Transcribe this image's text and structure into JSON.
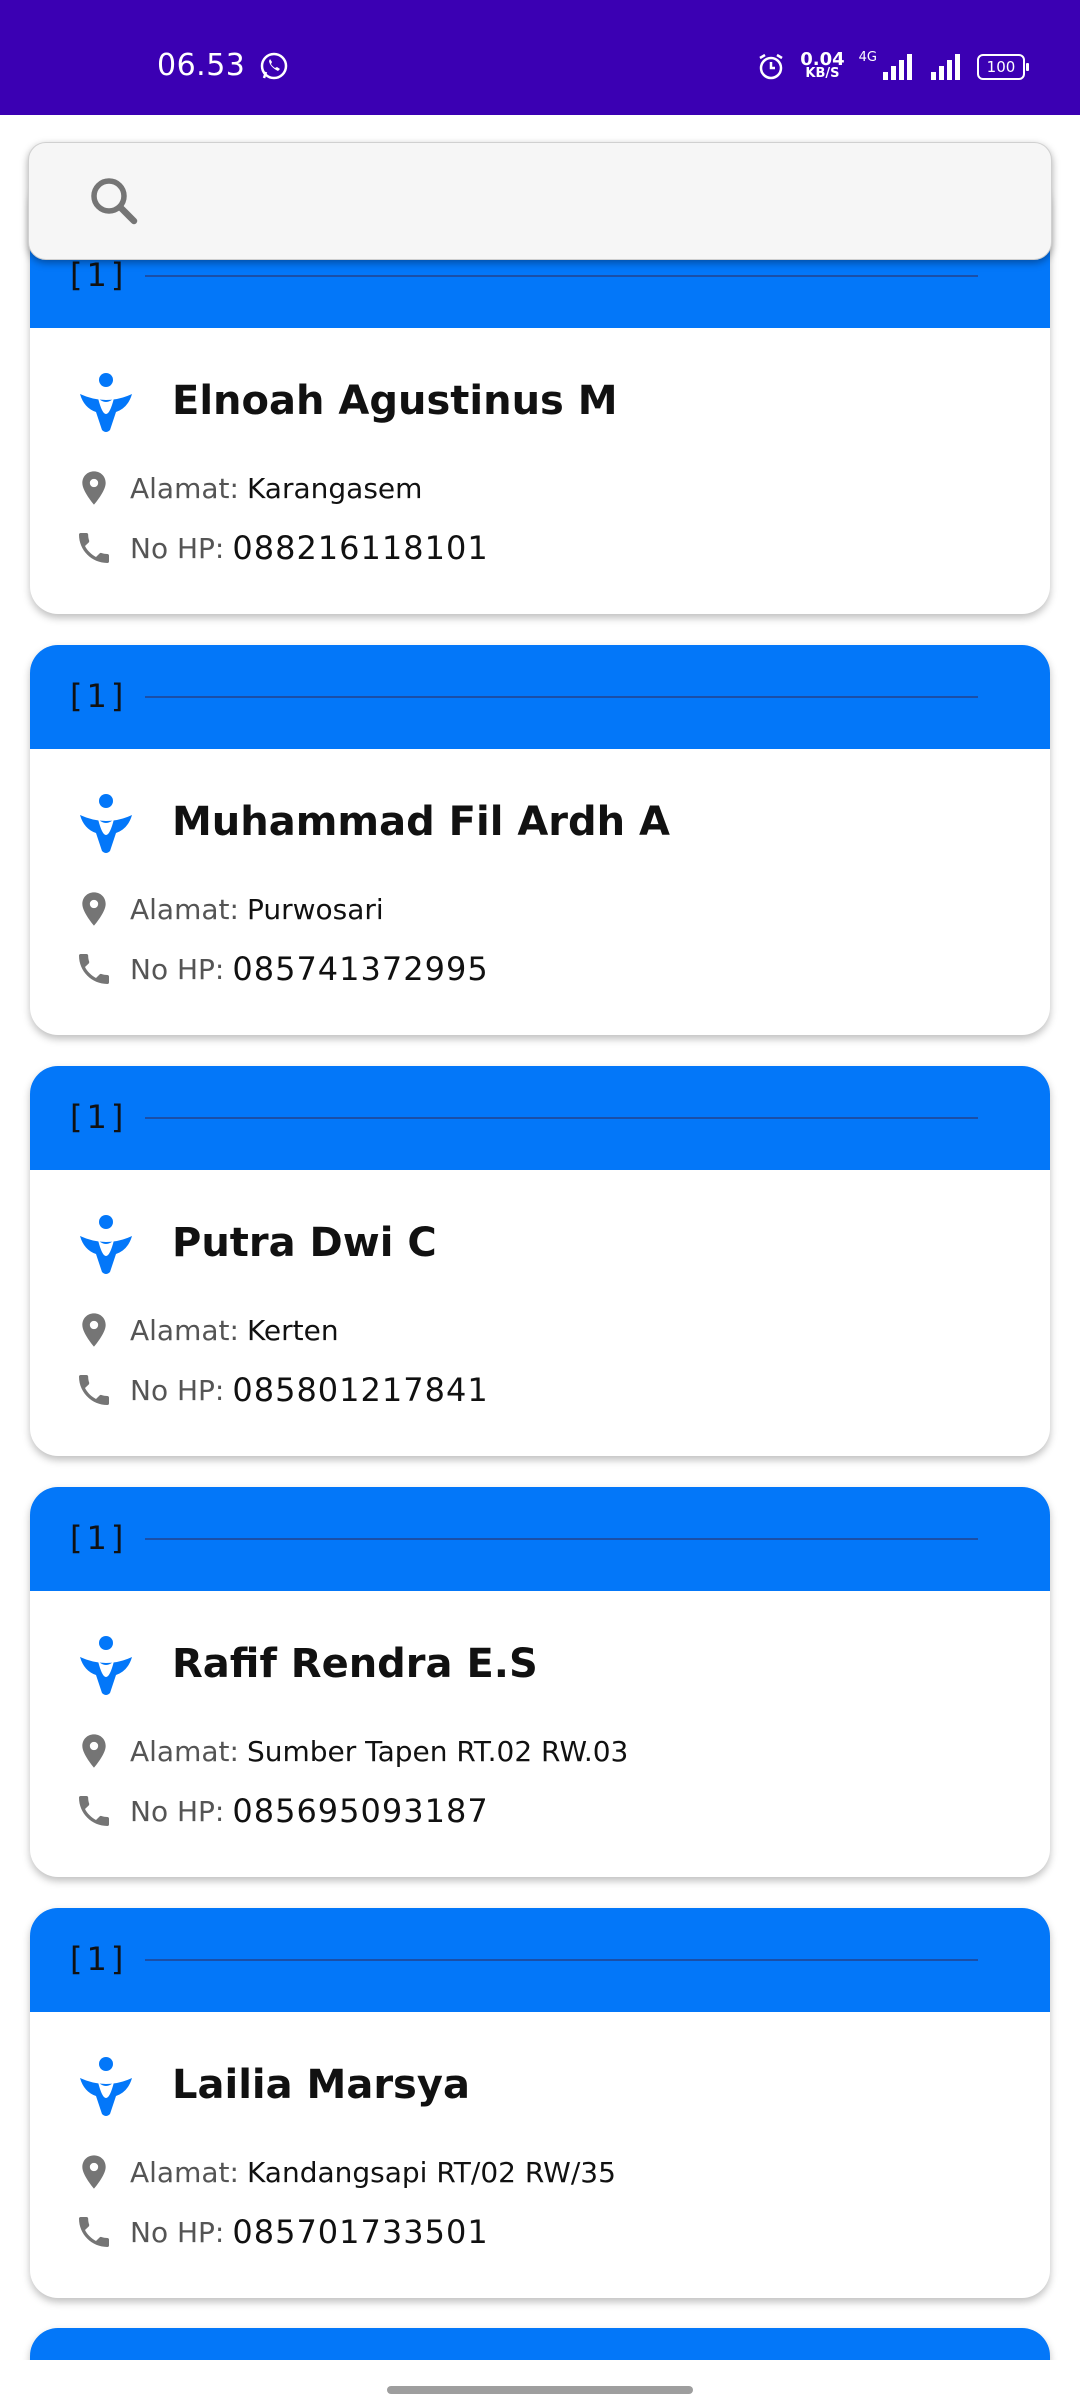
{
  "status_bar": {
    "time": "06.53",
    "net_speed": "0.04",
    "net_unit": "KB/S",
    "network_type": "4G",
    "battery": "100"
  },
  "search": {
    "placeholder": ""
  },
  "labels": {
    "address": "Alamat:",
    "phone": "No HP:"
  },
  "contacts": [
    {
      "count": "[1]",
      "name": "Elnoah Agustinus M",
      "address": "Karangasem",
      "phone": "088216118101"
    },
    {
      "count": "[1]",
      "name": "Muhammad Fil Ardh A",
      "address": "Purwosari",
      "phone": "085741372995"
    },
    {
      "count": "[1]",
      "name": "Putra Dwi C",
      "address": "Kerten",
      "phone": "085801217841"
    },
    {
      "count": "[1]",
      "name": "Rafif Rendra E.S",
      "address": "Sumber Tapen RT.02 RW.03",
      "phone": "085695093187"
    },
    {
      "count": "[1]",
      "name": "Lailia Marsya",
      "address": "Kandangsapi RT/02 RW/35",
      "phone": "085701733501"
    }
  ],
  "colors": {
    "status_bar": "#3b00b3",
    "card_header": "#0377f9"
  }
}
